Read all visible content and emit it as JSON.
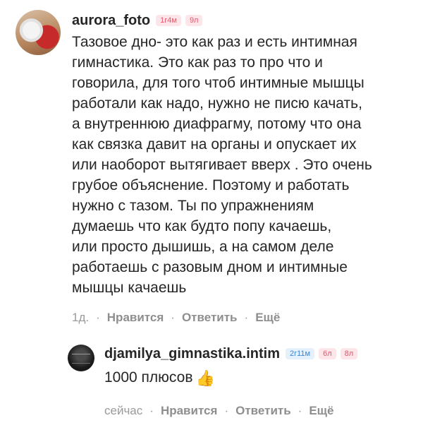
{
  "comments": [
    {
      "username": "aurora_foto",
      "badges": [
        "1г4м",
        "9л"
      ],
      "text": "Тазовое дно- это как раз и есть интимная\nгимнастика. Это как раз то про что и\nговорила, для того чтоб интимные мышцы\nработали как надо, нужно не писю качать,\nа внутреннюю диафрагму, потому что она\nкак связка давит на органы и опускает их\nили наоборот вытягивает вверх . Это очень\nгрубое  объяснение. Поэтому и работать\nнужно с тазом. Ты по упражнениям\nдумаешь что как будто попу качаешь,\nили просто дышишь, а на самом деле\nработаешь с разовым дном и интимные\nмышцы качаешь",
      "time": "1д.",
      "like_label": "Нравится",
      "reply_label": "Ответить",
      "more_label": "Ещё"
    },
    {
      "username": "djamilya_gimnastika.intim",
      "badges": [
        "2г11м",
        "6л",
        "8л"
      ],
      "text": "1000 плюсов",
      "emoji": "👍",
      "time": "сейчас",
      "like_label": "Нравится",
      "reply_label": "Ответить",
      "more_label": "Ещё"
    }
  ],
  "separator": "·",
  "colors": {
    "badge_pink_bg": "#fde6ea",
    "badge_pink_text": "#e4576b",
    "badge_blue_bg": "#e4f0fc",
    "badge_blue_text": "#3d86d3",
    "action_text": "#8e8e8e"
  }
}
